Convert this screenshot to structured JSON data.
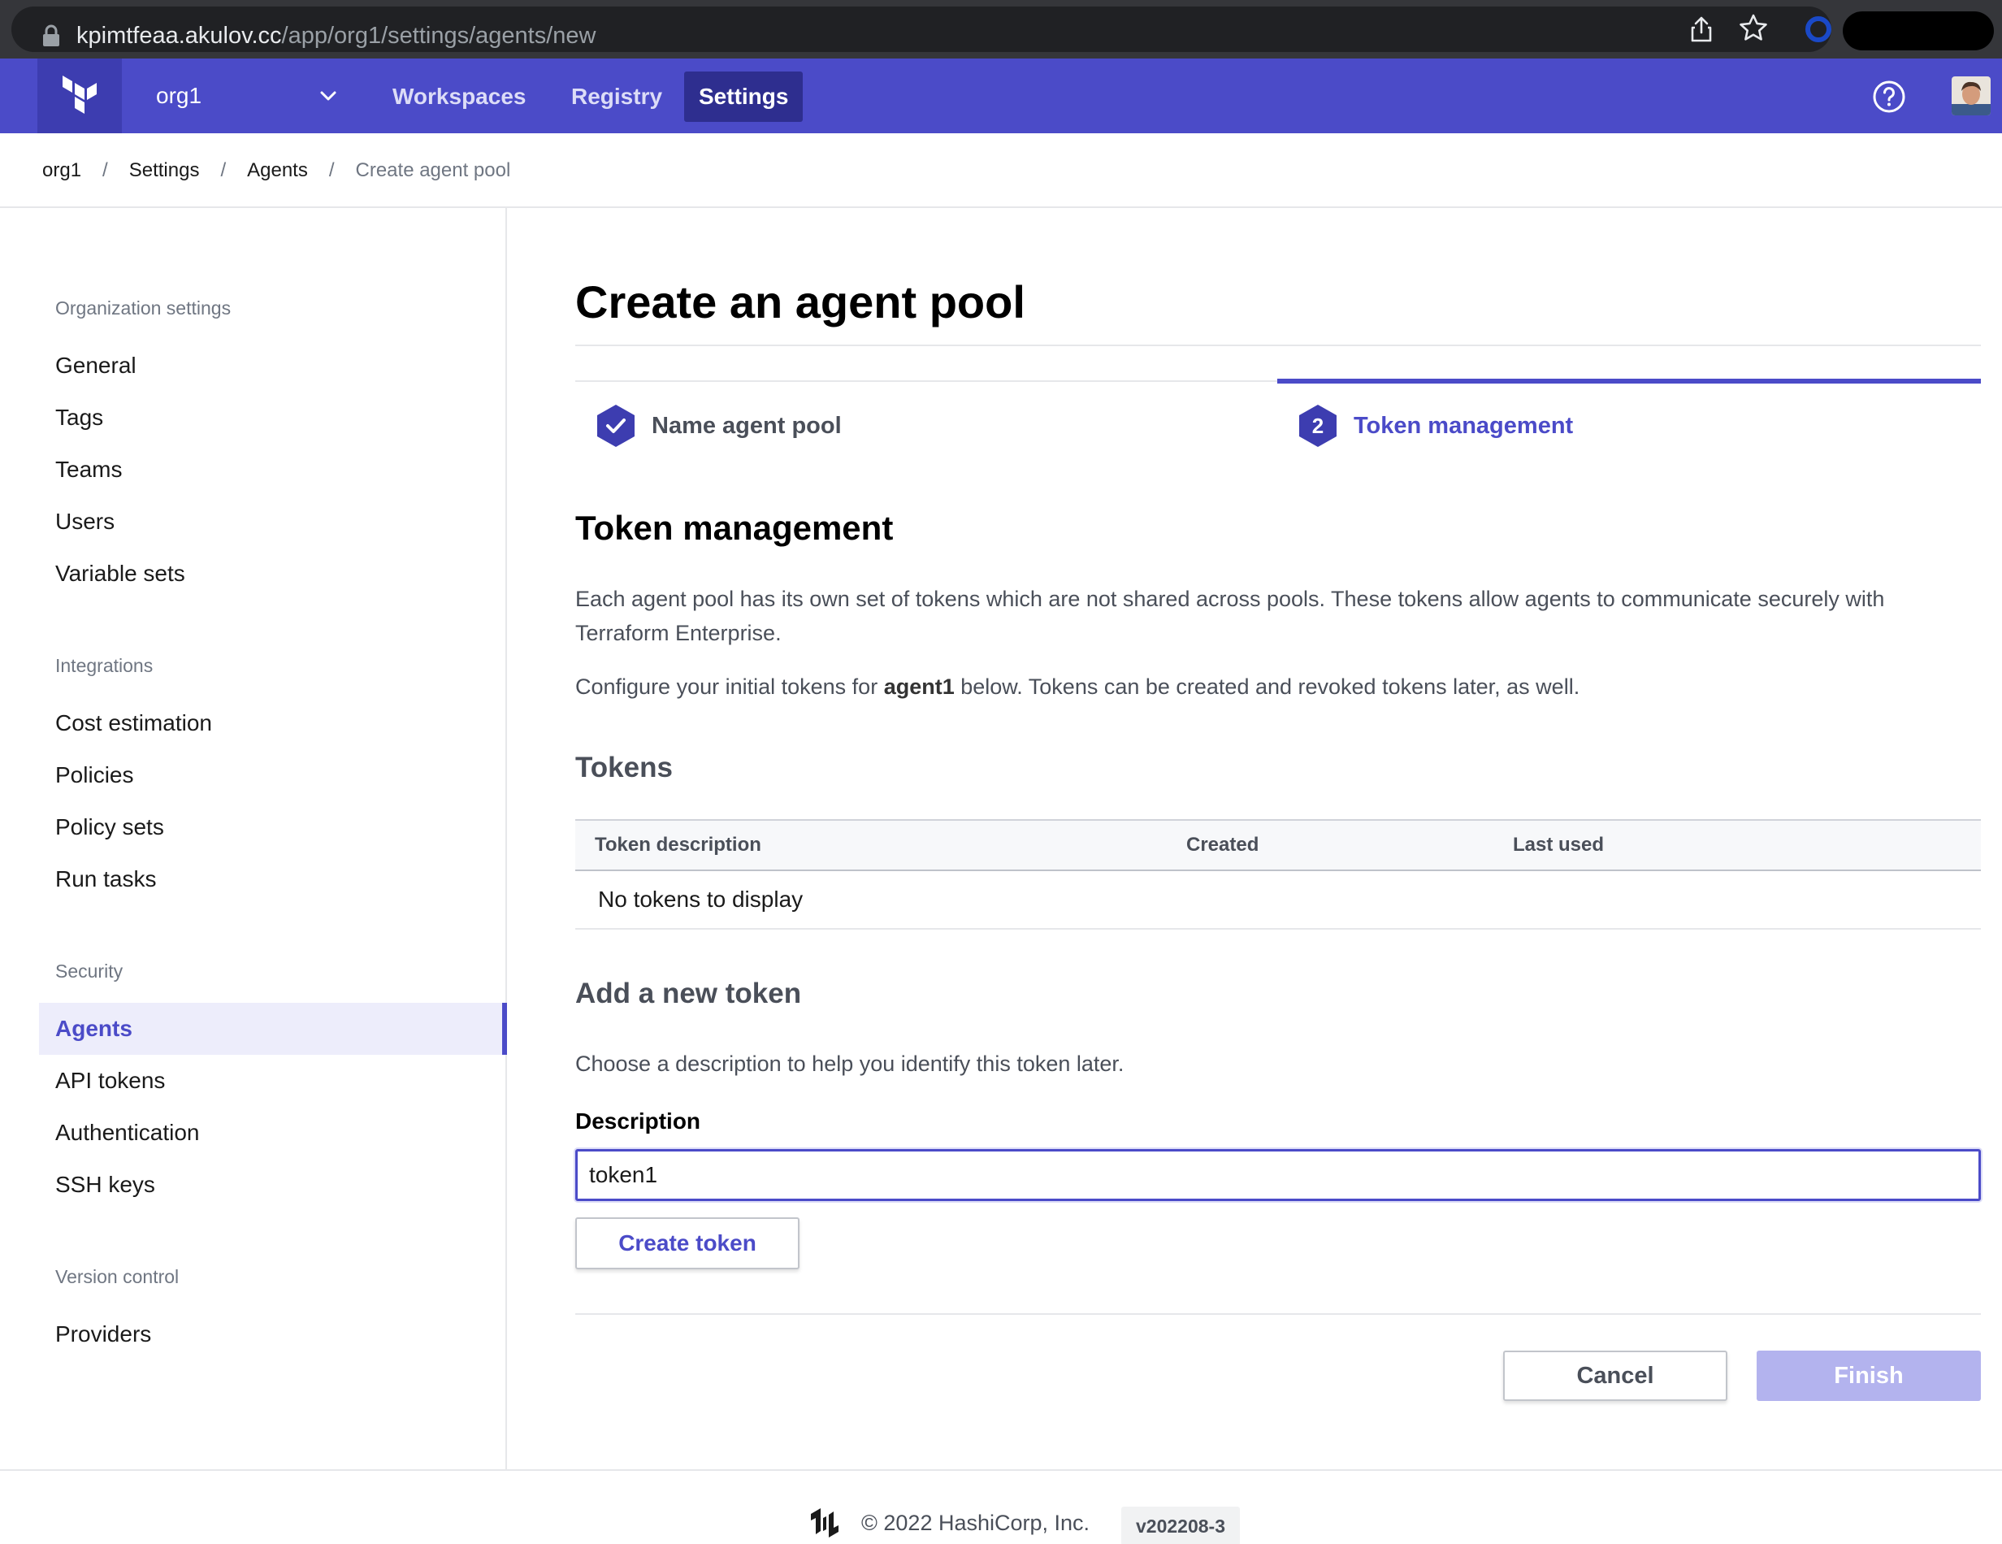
{
  "browser": {
    "url_host": "kpimtfeaa.akulov.cc",
    "url_path": "/app/org1/settings/agents/new"
  },
  "topnav": {
    "org_name": "org1",
    "items": [
      {
        "label": "Workspaces"
      },
      {
        "label": "Registry"
      },
      {
        "label": "Settings",
        "active": true
      }
    ]
  },
  "breadcrumb": {
    "items": [
      "org1",
      "Settings",
      "Agents",
      "Create agent pool"
    ],
    "separator": "/"
  },
  "sidebar": {
    "sections": [
      {
        "heading": "Organization settings",
        "items": [
          "General",
          "Tags",
          "Teams",
          "Users",
          "Variable sets"
        ]
      },
      {
        "heading": "Integrations",
        "items": [
          "Cost estimation",
          "Policies",
          "Policy sets",
          "Run tasks"
        ]
      },
      {
        "heading": "Security",
        "items": [
          "Agents",
          "API tokens",
          "Authentication",
          "SSH keys"
        ]
      },
      {
        "heading": "Version control",
        "items": [
          "Providers"
        ]
      }
    ],
    "active_item": "Agents"
  },
  "page": {
    "title": "Create an agent pool",
    "steps": [
      {
        "label": "Name agent pool",
        "state": "complete"
      },
      {
        "number": "2",
        "label": "Token management",
        "state": "current"
      }
    ],
    "section_title": "Token management",
    "intro": "Each agent pool has its own set of tokens which are not shared across pools. These tokens allow agents to communicate securely with Terraform Enterprise.",
    "configure_prefix": "Configure your initial tokens for ",
    "pool_name": "agent1",
    "configure_suffix": " below. Tokens can be created and revoked tokens later, as well.",
    "tokens_heading": "Tokens",
    "table": {
      "columns": [
        "Token description",
        "Created",
        "Last used"
      ],
      "empty_text": "No tokens to display"
    },
    "add_heading": "Add a new token",
    "add_help": "Choose a description to help you identify this token later.",
    "description_label": "Description",
    "description_value": "token1",
    "create_button": "Create token",
    "cancel_button": "Cancel",
    "finish_button": "Finish"
  },
  "footer": {
    "copyright": "© 2022 HashiCorp, Inc.",
    "version": "v202208-3"
  },
  "colors": {
    "brand": "#4b4bc8",
    "brand_dark": "#3d3db0",
    "finish_disabled": "#b3b3ee"
  }
}
